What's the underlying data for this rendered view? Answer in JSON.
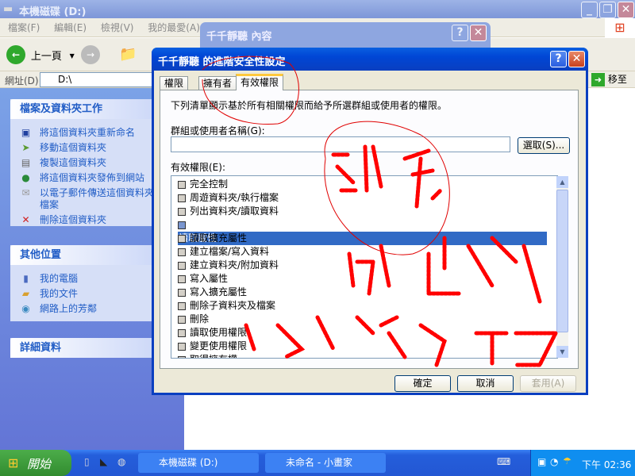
{
  "explorer": {
    "title": "本機磁碟 (D:)",
    "menu": [
      "檔案(F)",
      "編輯(E)",
      "檢視(V)",
      "我的最愛(A)"
    ],
    "toolbar": {
      "back": "上一頁"
    },
    "address": {
      "label": "網址(D)",
      "value": "D:\\",
      "go": "移至"
    },
    "left_pane": {
      "tasks": {
        "title": "檔案及資料夾工作",
        "items": [
          {
            "label": "將這個資料夾重新命名",
            "icon": "rename-icon"
          },
          {
            "label": "移動這個資料夾",
            "icon": "move-icon"
          },
          {
            "label": "複製這個資料夾",
            "icon": "copy-icon"
          },
          {
            "label": "將這個資料夾發佈到網站",
            "icon": "publish-icon"
          },
          {
            "label": "以電子郵件傳送這個資料夾的檔案",
            "icon": "email-icon"
          },
          {
            "label": "刪除這個資料夾",
            "icon": "delete-icon"
          }
        ]
      },
      "places": {
        "title": "其他位置",
        "items": [
          {
            "label": "我的電腦",
            "icon": "computer-icon"
          },
          {
            "label": "我的文件",
            "icon": "documents-icon"
          },
          {
            "label": "網路上的芳鄰",
            "icon": "network-icon"
          }
        ]
      },
      "details": {
        "title": "詳細資料"
      }
    }
  },
  "back_dialog": {
    "title": "千千靜聽 內容"
  },
  "dialog": {
    "title": "千千靜聽 的進階安全性設定",
    "tabs": [
      "權限",
      "擁有者",
      "有效權限"
    ],
    "active_tab": 2,
    "description": "下列清單顯示基於所有相關權限而給予所選群組或使用者的權限。",
    "group_label": "群組或使用者名稱(G):",
    "group_value": "",
    "select_button": "選取(S)...",
    "perms_label": "有效權限(E):",
    "permissions": [
      "完全控制",
      "周遊資料夾/執行檔案",
      "列出資料夾/讀取資料",
      "讀取屬性",
      "讀取擴充屬性",
      "建立檔案/寫入資料",
      "建立資料夾/附加資料",
      "寫入屬性",
      "寫入擴充屬性",
      "刪除子資料夾及檔案",
      "刪除",
      "讀取使用權限",
      "變更使用權限",
      "取得擁有權"
    ],
    "selected_permission": 3,
    "ok": "確定",
    "cancel": "取消",
    "apply": "套用(A)"
  },
  "taskbar": {
    "start": "開始",
    "tasks": [
      "本機磁碟 (D:)",
      "未命名 - 小畫家"
    ],
    "clock": "下午 02:36"
  },
  "colors": {
    "annotation": "#ff0000",
    "selection": "#316ac5",
    "taskbar": "#245edb"
  }
}
